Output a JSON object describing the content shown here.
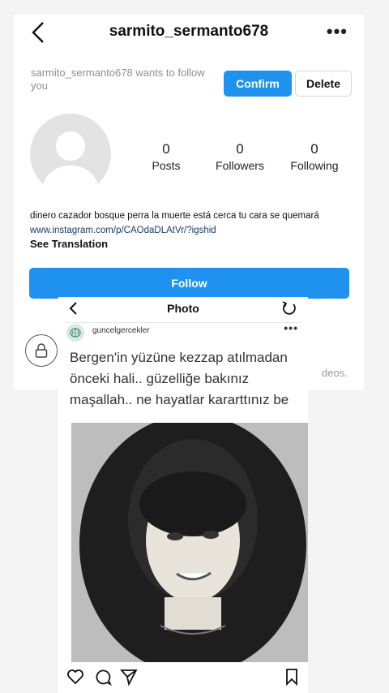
{
  "profile": {
    "username": "sarmito_sermanto678",
    "more_label": "•••",
    "request_text": "sarmito_sermanto678 wants to follow you",
    "confirm_label": "Confirm",
    "delete_label": "Delete",
    "stats": [
      {
        "value": "0",
        "label": "Posts"
      },
      {
        "value": "0",
        "label": "Followers"
      },
      {
        "value": "0",
        "label": "Following"
      }
    ],
    "bio": "dinero cazador bosque perra la muerte está cerca tu cara se quemará",
    "link": "www.instagram.com/p/CAOdaDLAtVr/?igshid",
    "see_translation": "See Translation",
    "follow_label": "Follow",
    "private_text_fragment": "deos."
  },
  "photo_view": {
    "title": "Photo",
    "post_username": "guncelgercekler",
    "post_more": "•••",
    "caption": "Bergen'in yüzüne kezzap atılmadan önceki hali.. güzelliğe bakınız maşallah.. ne hayatlar karart­tınız be",
    "icons": [
      "back-arrow-icon",
      "reload-icon",
      "heart-icon",
      "comment-icon",
      "share-icon",
      "bookmark-icon"
    ]
  },
  "colors": {
    "primary_button": "#1f92ef",
    "muted_text": "#8e8e8e",
    "link_text": "#1d3a6b"
  }
}
